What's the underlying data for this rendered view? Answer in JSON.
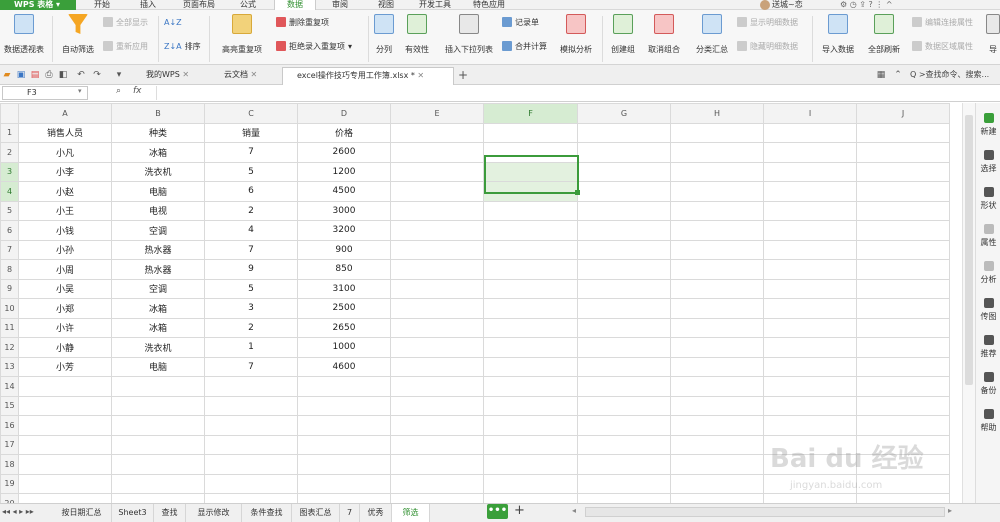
{
  "app": {
    "name": "WPS 表格"
  },
  "menu_tabs": [
    "开始",
    "插入",
    "页面布局",
    "公式",
    "数据",
    "审阅",
    "视图",
    "开发工具",
    "特色应用"
  ],
  "active_menu_tab": "数据",
  "top_right": {
    "user": "送城~恋"
  },
  "ribbon": {
    "pivot": "数据透视表",
    "autofilter": "自动筛选",
    "show_all": "全部显示",
    "reapply": "重新应用",
    "sort": "排序",
    "highlight_dup": "高亮重复项",
    "remove_dup": "删除重复项",
    "reject_dup": "拒绝录入重复项",
    "split": "分列",
    "validity": "有效性",
    "insert_dropdown": "插入下拉列表",
    "record": "记录单",
    "consolidate": "合并计算",
    "simulate": "模拟分析",
    "group": "创建组",
    "ungroup": "取消组合",
    "subtotal": "分类汇总",
    "show_detail": "显示明细数据",
    "hide_detail": "隐藏明细数据",
    "import": "导入数据",
    "refresh_all": "全部刷新",
    "edit_links": "编辑连接属性",
    "range_props": "数据区域属性",
    "more": "导"
  },
  "doc_tabs": [
    {
      "label": "我的WPS"
    },
    {
      "label": "云文档"
    },
    {
      "label": "excel操作技巧专用工作簿.xlsx *"
    }
  ],
  "search_placeholder": "Q >查找命令、搜索...",
  "name_box": "F3",
  "fx": "fx",
  "columns": [
    "A",
    "B",
    "C",
    "D",
    "E",
    "F",
    "G",
    "H",
    "I",
    "J"
  ],
  "rows": [
    [
      "销售人员",
      "种类",
      "销量",
      "价格"
    ],
    [
      "小凡",
      "冰箱",
      "7",
      "2600"
    ],
    [
      "小李",
      "洗衣机",
      "5",
      "1200"
    ],
    [
      "小赵",
      "电脑",
      "6",
      "4500"
    ],
    [
      "小王",
      "电视",
      "2",
      "3000"
    ],
    [
      "小钱",
      "空调",
      "4",
      "3200"
    ],
    [
      "小孙",
      "热水器",
      "7",
      "900"
    ],
    [
      "小周",
      "热水器",
      "9",
      "850"
    ],
    [
      "小吴",
      "空调",
      "5",
      "3100"
    ],
    [
      "小郑",
      "冰箱",
      "3",
      "2500"
    ],
    [
      "小许",
      "冰箱",
      "2",
      "2650"
    ],
    [
      "小静",
      "洗衣机",
      "1",
      "1000"
    ],
    [
      "小芳",
      "电脑",
      "7",
      "4600"
    ],
    [
      "",
      "",
      "",
      ""
    ],
    [
      "",
      "",
      "",
      ""
    ],
    [
      "",
      "",
      "",
      ""
    ],
    [
      "",
      "",
      "",
      ""
    ],
    [
      "",
      "",
      "",
      ""
    ],
    [
      "",
      "",
      "",
      ""
    ],
    [
      "",
      "",
      "",
      ""
    ]
  ],
  "right_pane": [
    "新建",
    "选择",
    "形状",
    "属性",
    "分析",
    "传图",
    "推荐",
    "备份",
    "帮助"
  ],
  "sheet_tabs": [
    "按日期汇总",
    "Sheet3",
    "查找",
    "显示修改",
    "条件查找",
    "图表汇总",
    "7",
    "优秀",
    "筛选"
  ],
  "active_sheet": "筛选",
  "more_sheets": "•••",
  "add_sheet": "+",
  "watermark": {
    "main": "Bai du 经验",
    "sub": "jingyan.baidu.com"
  },
  "colors": {
    "accent": "#3a9f3a",
    "selection": "#d6ecd2"
  }
}
